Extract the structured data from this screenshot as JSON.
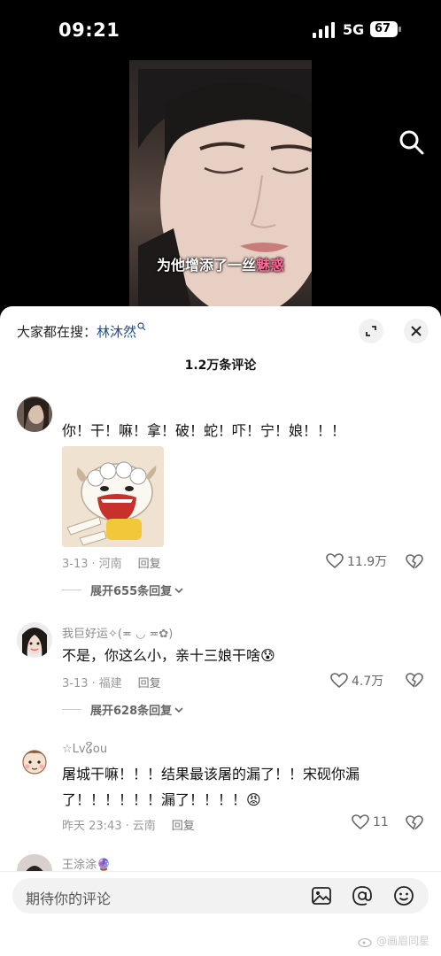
{
  "status_bar": {
    "time": "09:21",
    "network": "5G",
    "battery": "67"
  },
  "video": {
    "subtitle_prefix": "为他增添了一丝",
    "subtitle_highlight": "魅惑"
  },
  "sheet": {
    "trend_prefix": "大家都在搜：",
    "trend_keyword": "林沐然",
    "comment_count": "1.2万条评论"
  },
  "comments": [
    {
      "username": "",
      "text": "你！干！嘛！拿！破！蛇！吓！宁！娘！！！",
      "date": "3-13",
      "location": "河南",
      "reply_label": "回复",
      "likes": "11.9万",
      "expand": "展开655条回复"
    },
    {
      "username": "我巨好运✧(≖ ◡ ≖✿)",
      "text": "不是，你这么小，亲十三娘干啥😰",
      "date": "3-13",
      "location": "福建",
      "reply_label": "回复",
      "likes": "4.7万",
      "expand": "展开628条回复"
    },
    {
      "username": "☆Lv໒ິou",
      "text_line1": "屠城干嘛！！！结果最该屠的漏了！！宋砚你漏",
      "text_line2": "了！！！！！！漏了！！！！😡",
      "date": "昨天 23:43",
      "location": "云南",
      "reply_label": "回复",
      "likes": "11"
    },
    {
      "username": "王涂涂🔮"
    }
  ],
  "input": {
    "placeholder": "期待你的评论"
  },
  "watermark": "@画眉同星",
  "icons": {
    "search": "search-icon",
    "expand": "expand-icon",
    "close": "close-icon",
    "like": "heart-icon",
    "dislike": "broken-heart-icon",
    "image": "image-icon",
    "mention": "at-icon",
    "emoji": "emoji-icon"
  },
  "colors": {
    "keyword": "#1d4e8f",
    "subtitle_highlight": "#ff6b9a"
  }
}
